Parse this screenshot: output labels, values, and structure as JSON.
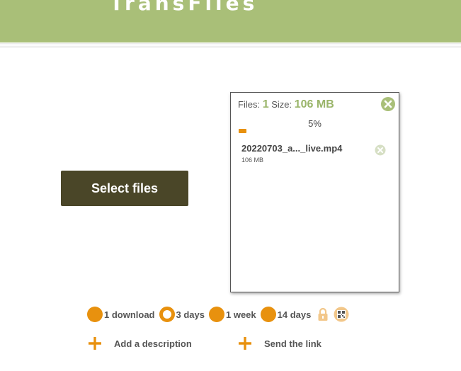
{
  "header": {
    "title": "TransFiles"
  },
  "upload": {
    "select_label": "Select files"
  },
  "panel": {
    "files_label": "Files:",
    "files_count": "1",
    "size_label": "Size:",
    "size_value": "106 MB",
    "percent": "5%",
    "progress_fraction": 0.05,
    "file": {
      "name": "20220703_a..._live.mp4",
      "size": "106 MB"
    }
  },
  "options": {
    "download": "1 download",
    "three_days": "3 days",
    "one_week": "1 week",
    "fourteen_days": "14 days",
    "selected": "3 days"
  },
  "actions": {
    "add_description": "Add a description",
    "send_link": "Send the link"
  },
  "icons": {
    "close": "circle-x-icon",
    "lock": "lock-icon",
    "qr": "qr-code-icon",
    "plus": "plus-icon"
  },
  "colors": {
    "header": "#a9bf78",
    "accent": "#e8910e",
    "button": "#4a4628",
    "count": "#9ab56a"
  }
}
